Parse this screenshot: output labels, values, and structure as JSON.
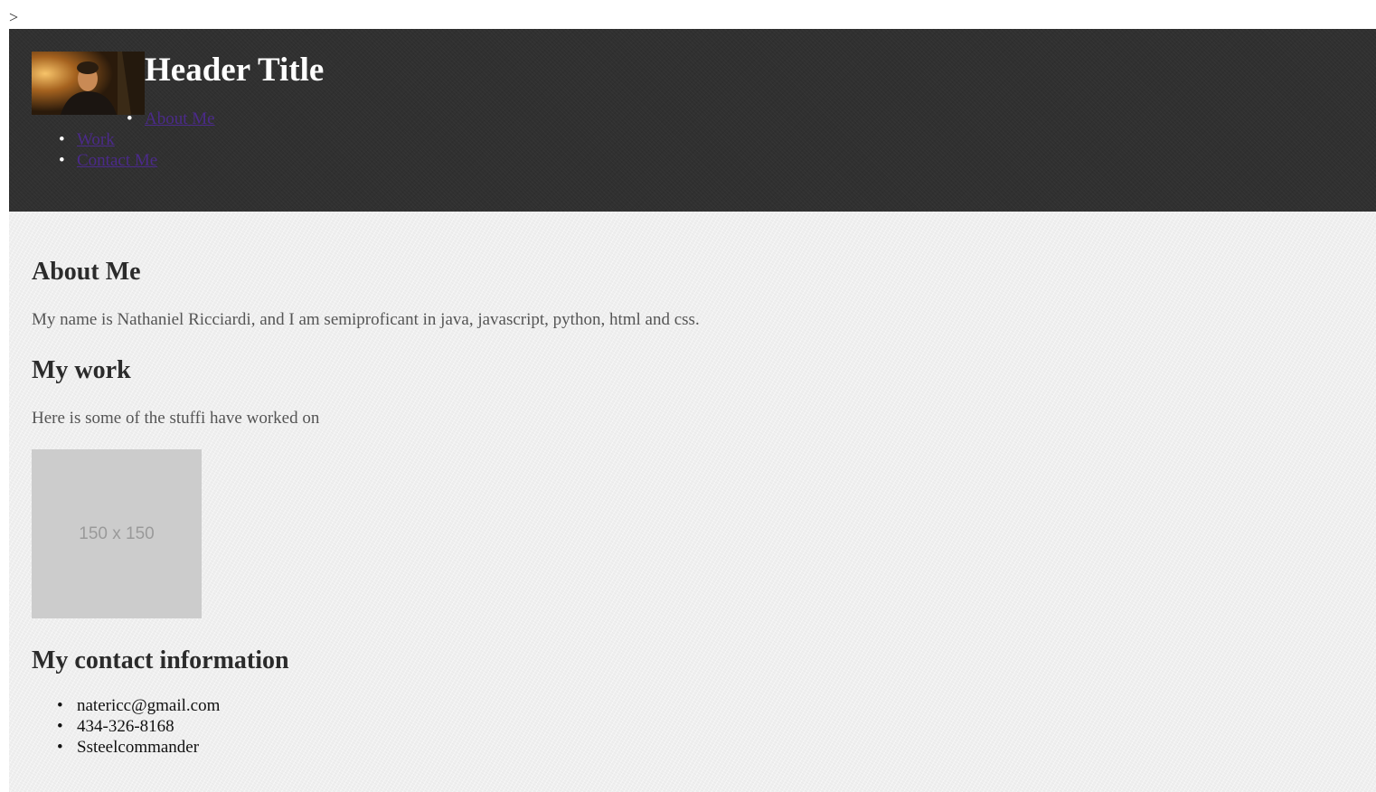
{
  "stray_text": ">",
  "header": {
    "avatar_alt": "profile photo",
    "title": "Header Title",
    "nav": [
      {
        "label": "About Me"
      },
      {
        "label": "Work"
      },
      {
        "label": "Contact Me"
      }
    ],
    "bullet": "•"
  },
  "main": {
    "about": {
      "heading": "About Me",
      "text": "My name is Nathaniel Ricciardi, and I am semiproficant in java, javascript, python, html and css."
    },
    "work": {
      "heading": "My work",
      "text": "Here is some of the stuffi have worked on",
      "placeholder_label": "150 x 150"
    },
    "contact": {
      "heading": "My contact information",
      "items": [
        "natericc@gmail.com",
        "434-326-8168",
        "Ssteelcommander"
      ]
    }
  },
  "colors": {
    "header_bg": "#303030",
    "main_bg": "#efefef",
    "link": "#4b2a8a",
    "placeholder_bg": "#cccccc"
  }
}
